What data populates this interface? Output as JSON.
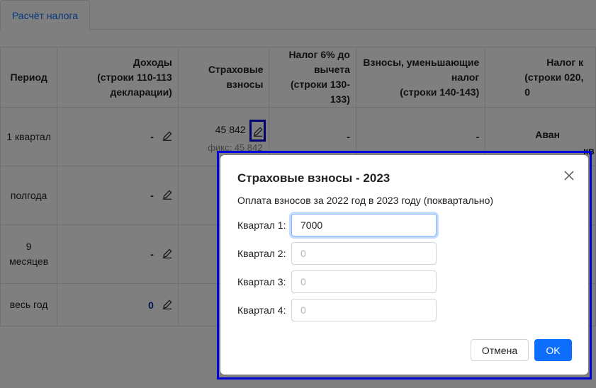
{
  "tabs": [
    {
      "label": "Расчёт налога",
      "active": true
    }
  ],
  "table": {
    "headers": {
      "period": "Период",
      "income": [
        "Доходы",
        "(строки 110-113",
        "декларации)"
      ],
      "insurance": [
        "Страховые",
        "взносы"
      ],
      "tax6": [
        "Налог 6% до",
        "вычета",
        "(строки 130-133)"
      ],
      "reducing": [
        "Взносы, уменьшающие",
        "налог",
        "(строки 140-143)"
      ],
      "payable": [
        "Налог к",
        "(строки 020, 0"
      ]
    },
    "rows": [
      {
        "period": [
          "1 квартал"
        ],
        "income": "-",
        "insurance_value": "45 842",
        "insurance_fixed": "фикс: 45 842",
        "tax6": "-",
        "reducing": "-",
        "advance": "Аван",
        "advance_cont": "кв"
      },
      {
        "period": [
          "полгода"
        ],
        "income": "-"
      },
      {
        "period": [
          "9",
          "месяцев"
        ],
        "income": "-"
      },
      {
        "period": [
          "весь год"
        ],
        "income": "0"
      }
    ]
  },
  "modal": {
    "title": "Страховые взносы - 2023",
    "subtitle": "Оплата взносов за 2022 год в 2023 году (поквартально)",
    "quarters": [
      {
        "label": "Квартал 1:",
        "value": "7000",
        "placeholder": "0"
      },
      {
        "label": "Квартал 2:",
        "value": "",
        "placeholder": "0"
      },
      {
        "label": "Квартал 3:",
        "value": "",
        "placeholder": "0"
      },
      {
        "label": "Квартал 4:",
        "value": "",
        "placeholder": "0"
      }
    ],
    "cancel_label": "Отмена",
    "ok_label": "OK"
  },
  "colors": {
    "accent": "#0d6efd",
    "highlight_frame": "#0000dd"
  }
}
